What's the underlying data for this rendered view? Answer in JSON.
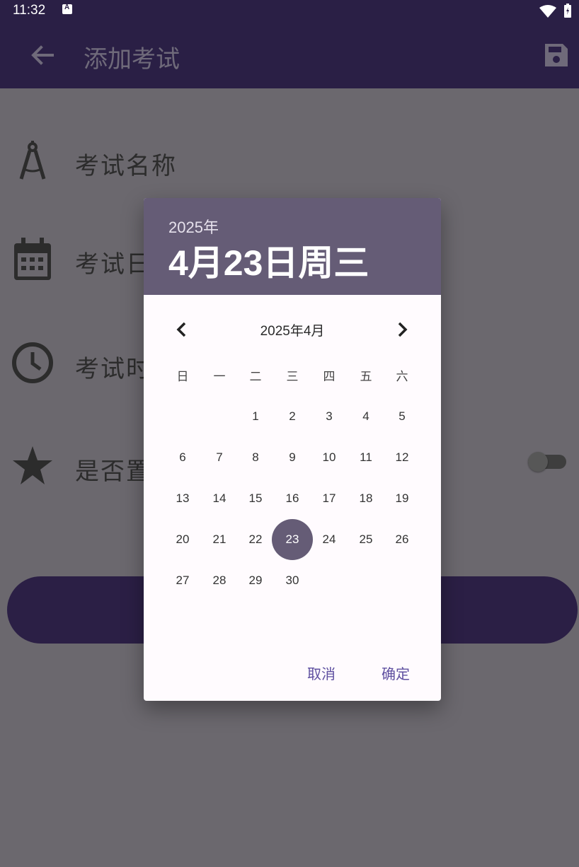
{
  "status_bar": {
    "time": "11:32"
  },
  "app_bar": {
    "title": "添加考试"
  },
  "form": {
    "exam_name_label": "考试名称",
    "exam_date_label": "考试日",
    "exam_time_label": "考试时",
    "pin_label": "是否置"
  },
  "dialog": {
    "year": "2025年",
    "selected_date": "4月23日周三",
    "month_title": "2025年4月",
    "weekdays": [
      "日",
      "一",
      "二",
      "三",
      "四",
      "五",
      "六"
    ],
    "days": [
      "1",
      "2",
      "3",
      "4",
      "5",
      "6",
      "7",
      "8",
      "9",
      "10",
      "11",
      "12",
      "13",
      "14",
      "15",
      "16",
      "17",
      "18",
      "19",
      "20",
      "21",
      "22",
      "23",
      "24",
      "25",
      "26",
      "27",
      "28",
      "29",
      "30"
    ],
    "selected_day": "23",
    "cancel_label": "取消",
    "ok_label": "确定"
  },
  "colors": {
    "primary_dark": "#2a1f45",
    "dialog_header": "#655c76",
    "scrim_bg": "#6b686e",
    "button_text": "#5e4fa0"
  },
  "icons": {
    "back": "arrow-left-icon",
    "save": "floppy-disk-icon",
    "name": "compass-icon",
    "date": "calendar-icon",
    "time": "clock-icon",
    "pin": "star-icon",
    "prev": "chevron-left-icon",
    "next": "chevron-right-icon"
  }
}
